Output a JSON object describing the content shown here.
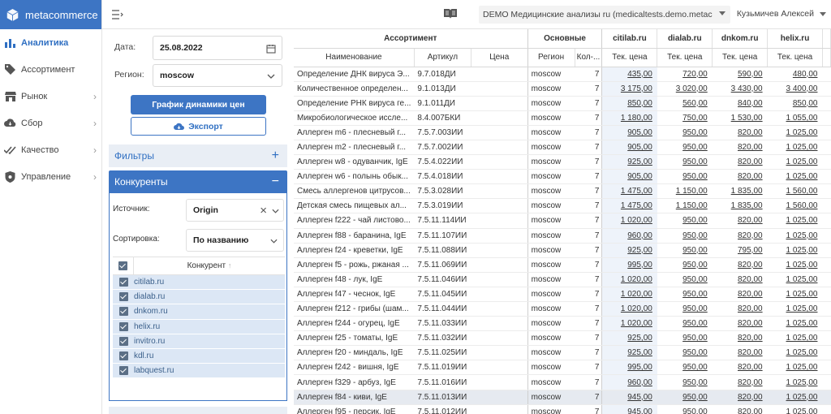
{
  "app": {
    "name": "metacommerce"
  },
  "nav": [
    {
      "label": "Аналитика",
      "icon": "bar-chart-icon",
      "active": true,
      "chevron": false
    },
    {
      "label": "Ассортимент",
      "icon": "tag-icon",
      "active": false,
      "chevron": false
    },
    {
      "label": "Рынок",
      "icon": "store-icon",
      "active": false,
      "chevron": true
    },
    {
      "label": "Сбор",
      "icon": "cloud-download-icon",
      "active": false,
      "chevron": true
    },
    {
      "label": "Качество",
      "icon": "check-double-icon",
      "active": false,
      "chevron": true
    },
    {
      "label": "Управление",
      "icon": "gear-shield-icon",
      "active": false,
      "chevron": true
    }
  ],
  "topbar": {
    "project": "DEMO Медицинские анализы ru (medicaltests.demo.metac",
    "user": "Кузьмичев Алексей"
  },
  "form": {
    "date_label": "Дата:",
    "date_value": "25.08.2022",
    "region_label": "Регион:",
    "region_value": "moscow",
    "chart_button": "График динамики цен",
    "export_button": "Экспорт"
  },
  "filters": {
    "title": "Фильтры",
    "competitors_title": "Конкуренты",
    "source_label": "Источник:",
    "source_value": "Origin",
    "sort_label": "Сортировка:",
    "sort_value": "По названию",
    "col_header": "Конкурент"
  },
  "competitors": [
    "citilab.ru",
    "dialab.ru",
    "dnkom.ru",
    "helix.ru",
    "invitro.ru",
    "kdl.ru",
    "labquest.ru"
  ],
  "grid": {
    "groups": {
      "assortment": "Ассортимент",
      "main": "Основные",
      "c1": "citilab.ru",
      "c2": "dialab.ru",
      "c3": "dnkom.ru",
      "c4": "helix.ru"
    },
    "cols": {
      "name": "Наименование",
      "sku": "Артикул",
      "price": "Цена",
      "region": "Регион",
      "count": "Кол-...",
      "cur": "Тек. цена"
    },
    "rows": [
      [
        "Определение ДНК вируса Э...",
        "9.7.018ДИ",
        "",
        "moscow",
        "7",
        "435,00",
        "720,00",
        "590,00",
        "480,00"
      ],
      [
        "Количественное определен...",
        "9.1.013ДИ",
        "",
        "moscow",
        "7",
        "3 175,00",
        "3 020,00",
        "3 430,00",
        "3 400,00"
      ],
      [
        "Определение РНК вируса ге...",
        "9.1.011ДИ",
        "",
        "moscow",
        "7",
        "850,00",
        "560,00",
        "840,00",
        "850,00"
      ],
      [
        "Микробиологическое иссле...",
        "8.4.007БКИ",
        "",
        "moscow",
        "7",
        "1 180,00",
        "750,00",
        "1 530,00",
        "1 055,00"
      ],
      [
        "Аллерген m6 - плесневый г...",
        "7.5.7.003ИИ",
        "",
        "moscow",
        "7",
        "905,00",
        "950,00",
        "820,00",
        "1 025,00"
      ],
      [
        "Аллерген m2 - плесневый г...",
        "7.5.7.002ИИ",
        "",
        "moscow",
        "7",
        "905,00",
        "950,00",
        "820,00",
        "1 025,00"
      ],
      [
        "Аллерген w8 - одуванчик, IgE",
        "7.5.4.022ИИ",
        "",
        "moscow",
        "7",
        "925,00",
        "950,00",
        "820,00",
        "1 025,00"
      ],
      [
        "Аллерген w6 - полынь обык...",
        "7.5.4.018ИИ",
        "",
        "moscow",
        "7",
        "905,00",
        "950,00",
        "820,00",
        "1 025,00"
      ],
      [
        "Смесь аллергенов цитрусов...",
        "7.5.3.028ИИ",
        "",
        "moscow",
        "7",
        "1 475,00",
        "1 150,00",
        "1 835,00",
        "1 560,00"
      ],
      [
        "Детская смесь пищевых ал...",
        "7.5.3.019ИИ",
        "",
        "moscow",
        "7",
        "1 475,00",
        "1 150,00",
        "1 835,00",
        "1 560,00"
      ],
      [
        "Аллерген f222 - чай листово...",
        "7.5.11.114ИИ",
        "",
        "moscow",
        "7",
        "1 020,00",
        "950,00",
        "820,00",
        "1 025,00"
      ],
      [
        "Аллерген f88 - баранина, IgE",
        "7.5.11.107ИИ",
        "",
        "moscow",
        "7",
        "960,00",
        "950,00",
        "820,00",
        "1 025,00"
      ],
      [
        "Аллерген f24 - креветки, IgE",
        "7.5.11.088ИИ",
        "",
        "moscow",
        "7",
        "925,00",
        "950,00",
        "795,00",
        "1 025,00"
      ],
      [
        "Аллерген f5 - рожь, ржаная ...",
        "7.5.11.069ИИ",
        "",
        "moscow",
        "7",
        "995,00",
        "950,00",
        "820,00",
        "1 025,00"
      ],
      [
        "Аллерген f48 - лук, IgE",
        "7.5.11.046ИИ",
        "",
        "moscow",
        "7",
        "1 020,00",
        "950,00",
        "820,00",
        "1 025,00"
      ],
      [
        "Аллерген f47 - чеснок, IgE",
        "7.5.11.045ИИ",
        "",
        "moscow",
        "7",
        "1 020,00",
        "950,00",
        "820,00",
        "1 025,00"
      ],
      [
        "Аллерген f212 - грибы (шам...",
        "7.5.11.044ИИ",
        "",
        "moscow",
        "7",
        "1 020,00",
        "950,00",
        "820,00",
        "1 025,00"
      ],
      [
        "Аллерген f244 - огурец, IgE",
        "7.5.11.033ИИ",
        "",
        "moscow",
        "7",
        "1 020,00",
        "950,00",
        "820,00",
        "1 025,00"
      ],
      [
        "Аллерген f25 - томаты, IgE",
        "7.5.11.032ИИ",
        "",
        "moscow",
        "7",
        "925,00",
        "950,00",
        "820,00",
        "1 025,00"
      ],
      [
        "Аллерген f20 - миндаль, IgE",
        "7.5.11.025ИИ",
        "",
        "moscow",
        "7",
        "925,00",
        "950,00",
        "820,00",
        "1 025,00"
      ],
      [
        "Аллерген f242 - вишня, IgE",
        "7.5.11.019ИИ",
        "",
        "moscow",
        "7",
        "995,00",
        "950,00",
        "820,00",
        "1 025,00"
      ],
      [
        "Аллерген f329 - арбуз, IgE",
        "7.5.11.016ИИ",
        "",
        "moscow",
        "7",
        "960,00",
        "950,00",
        "820,00",
        "1 025,00"
      ],
      [
        "Аллерген f84 - киви, IgE",
        "7.5.11.013ИИ",
        "",
        "moscow",
        "7",
        "945,00",
        "950,00",
        "820,00",
        "1 025,00"
      ],
      [
        "Аллерген f95 - персик, IgE",
        "7.5.11.012ИИ",
        "",
        "moscow",
        "7",
        "945,00",
        "950,00",
        "820,00",
        "1 025,00"
      ]
    ],
    "selected_row": 22
  }
}
